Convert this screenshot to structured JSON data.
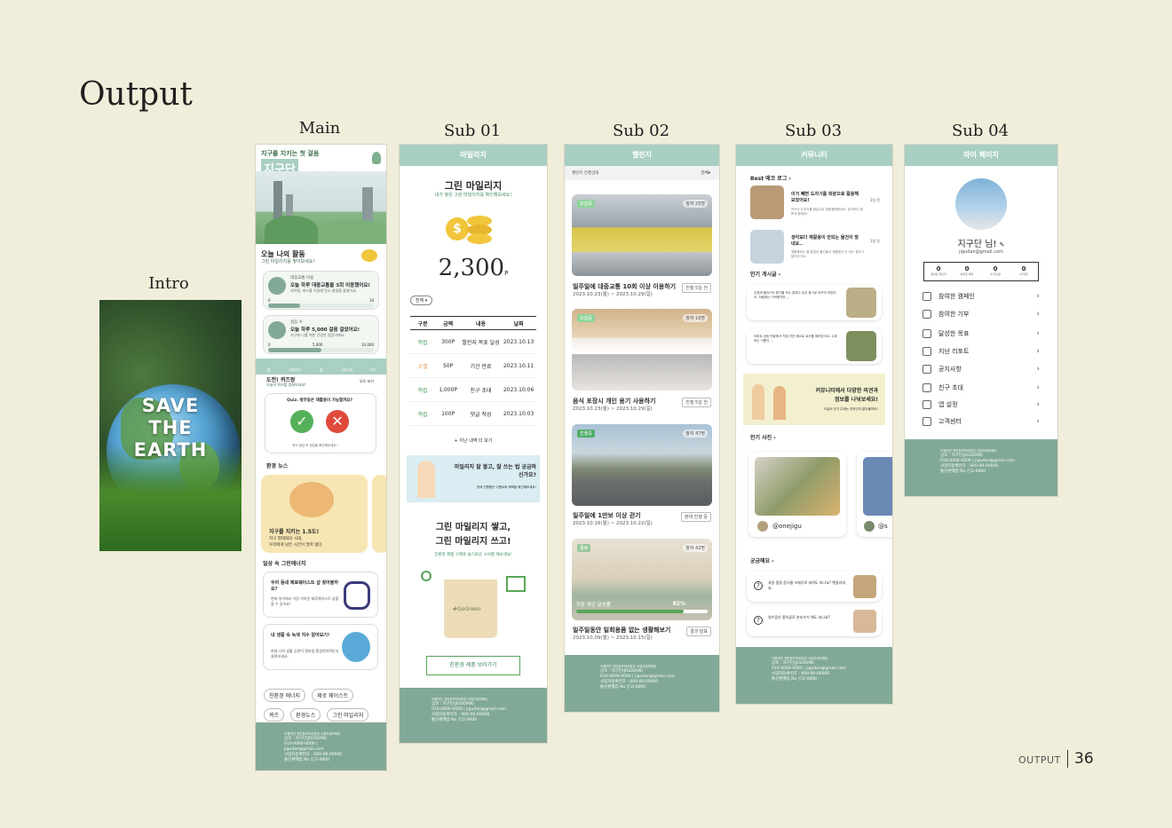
{
  "title": "Output",
  "labels": {
    "intro": "Intro",
    "main": "Main",
    "sub01": "Sub 01",
    "sub02": "Sub 02",
    "sub03": "Sub 03",
    "sub04": "Sub 04"
  },
  "intro": {
    "line1": "SAVE",
    "line2": "THE",
    "line3": "EARTH"
  },
  "main": {
    "tagline": "지구를 지키는 첫 걸음",
    "logo": "지구단",
    "badge": "녹색생활실천",
    "activity_title": "오늘 나의 활동",
    "activity_sub": "그린 마일리지를 쌓아보세요!",
    "card1_cat": "대중교통 이용",
    "card1_title": "오늘 하루 대중교통을 3회 이용했어요!",
    "card1_desc": "지하철, 버스를 이용해 탄소 발생을 줄였어요.",
    "card1_min": "0",
    "card1_max": "10",
    "card1_progress": 0.3,
    "card2_cat": "걸음 수",
    "card2_title": "오늘 하루 5,000 걸음 걸었어요!",
    "card2_desc": "지구에 나를 위한 건강한 걸음이에요.",
    "card2_min": "0",
    "card2_mid": "5,000",
    "card2_max": "10,000",
    "card2_progress": 0.5,
    "nav": [
      "홈",
      "마일리지",
      "홈",
      "커뮤니티",
      "마이"
    ],
    "quiz_title": "도전! 퀴즈왕",
    "quiz_sub": "오늘의 퀴즈를 맞춰보세요!",
    "quiz_more": "모두 보기",
    "quiz_q": "Quiz. 병주둥은 재활용이 가능할까요?",
    "quiz_note": "퀴즈 정답 후 정답을 확인해보세요!",
    "news_title": "환경 뉴스",
    "news_card_title": "지구를 지키는 1.5도!",
    "news_card_desc1": "지구 열대화의 시대,",
    "news_card_desc2": "우리에게 남은 시간이 얼마 없다.",
    "daily_title": "일상 속 그린에너지",
    "daily1_title": "우리 동네 제로웨이스트 샵 찾아볼까요?",
    "daily1_desc": "현재 위치에서 가장 가까운 제로웨이스트 샵을 볼 수 있어요!",
    "daily2_title": "내 생활 속 녹색 지수 알아보기!",
    "daily2_desc": "현재 나의 생활 습관이 얼마큼 환경친화적인지 살펴보세요.",
    "tags": [
      "친환경 에너지",
      "제로 웨이스트",
      "퀴즈",
      "환경뉴스",
      "그린 마일리지"
    ]
  },
  "sub01": {
    "header": "마일리지",
    "title": "그린 마일리지",
    "subtitle": "내가 쌓은 그린 마일리지를 확인해보세요!",
    "points": "2,300",
    "unit": "P",
    "filter": "전체",
    "columns": [
      "구분",
      "금액",
      "내용",
      "날짜"
    ],
    "rows": [
      [
        "적립",
        "300P",
        "챌린지 목표 달성",
        "2023.10.13"
      ],
      [
        "소멸",
        "50P",
        "기간 만료",
        "2023.10.11"
      ],
      [
        "적립",
        "1,000P",
        "친구 초대",
        "2023.10.06"
      ],
      [
        "적립",
        "100P",
        "댓글 작성",
        "2023.10.03"
      ]
    ],
    "more": "+ 지난 내역 더 보기",
    "banner_title": "마일리지 잘 쌓고, 잘 쓰는 법 궁금하신가요?",
    "banner_sub": "현재 진행중인 이벤트와 혜택을 확인해보세요!",
    "promo_title1": "그린 마일리지 쌓고,",
    "promo_title2": "그린 마일리지 쓰고!",
    "promo_sub": "친환경 제품 구매로 슬기로운 소비를 해보세요!",
    "bag_text": "#GoGreen",
    "button": "친환경 제품 보러가기"
  },
  "sub02": {
    "header": "챌린지",
    "filter_label": "챌린지 진행상태",
    "filter_value": "전체",
    "items": [
      {
        "tag": "모집중",
        "count": "참여 25명",
        "title": "일주일에 대중교통 10회 이상 이용하기",
        "date": "2023.10.23(월) ~ 2023.10.29(일)",
        "btn": "진행 5일 전"
      },
      {
        "tag": "모집중",
        "count": "참여 16명",
        "title": "음식 포장시 개인 용기 사용하기",
        "date": "2023.10.23(월) ~ 2023.10.29(일)",
        "btn": "진행 5일 전"
      },
      {
        "tag": "진행중",
        "count": "참여 47명",
        "title": "일주일에 1만보 이상 걷기",
        "date": "2023.10.16(월) ~ 2023.10.22(일)",
        "btn": "현재 진행 중"
      },
      {
        "tag": "종료",
        "count": "참여 42명",
        "title": "일주일동안 일회용품 없는 생활해보기",
        "date": "2023.10.09(월) ~ 2023.10.15(일)",
        "btn": "결과 발표",
        "result_label": "최종 평균 달성률",
        "result_value": "82%"
      }
    ]
  },
  "sub03": {
    "header": "커뮤니티",
    "best_title": "Best 에코 로그",
    "best1_title": "이거 빼면 도자기를 화분으로 활용해보았어요!",
    "best1_desc": "안쓰는 도자기를 화분으로 재활용해봤어요. 생각보다 예쁘게 됐네요!",
    "best1_time": "3일 전",
    "best2_title": "생각보다 재활용이 안되는 물건이 많네요..",
    "best2_desc": "재활용되는 줄 알았던 물건들이 재활용이 안 되는 경우가 많더라구요.",
    "best2_time": "1일 전",
    "popular_title": "인기 게시글",
    "post1": "주방에 플라스틱 용기를 모두 없애고 유리 용기로 바꾸어 보았어요. 처음에는 어색했지만 ...",
    "post2": "아파트 공동 텃밭에서 직접 키운 채소로 요리를 해보았어요. 수확하는 기쁨이 ...",
    "banner_title1": "커뮤니티에서 다양한 의견과",
    "banner_title2": "정보를 나눠보세요!",
    "banner_sub": "오늘의 인기 주제는 무엇인지 알아볼까요?",
    "photo_title": "인기 사진",
    "photo_user": "@onejigu",
    "photo_user2": "@s",
    "faq_title": "궁금해요",
    "faq1": "과일 껍질 음식물 쓰레기로 버려도 되나요? 헷갈리네요.",
    "faq2": "영수증은 종이류로 분리수거 해도 되나요?"
  },
  "sub04": {
    "header": "마이 페이지",
    "name": "지구단 님!",
    "email": "jigudan@gmail.com",
    "stats": [
      {
        "value": "0",
        "label": "참여한 챌린지"
      },
      {
        "value": "0",
        "label": "획득한 배지"
      },
      {
        "value": "0",
        "label": "내 게시글"
      },
      {
        "value": "0",
        "label": "내 댓글"
      }
    ],
    "menu": [
      "참여한 캠페인",
      "참여한 기부",
      "달성한 목표",
      "지난 리포트",
      "공지사항",
      "친구 초대",
      "앱 설정",
      "고객센터"
    ]
  },
  "footer": {
    "links": "이용약관   개인정보처리방침   사업자정보확인",
    "line1": "상호 : 지구단(JIGUDAN)",
    "line2": "010-0000-0000 | jigudan@gmail.com",
    "line3": "사업자등록번호 : 000-00-00000",
    "line4": "통신판매업 No 신고-0000"
  },
  "page_footer": {
    "label": "OUTPUT",
    "number": "36"
  }
}
